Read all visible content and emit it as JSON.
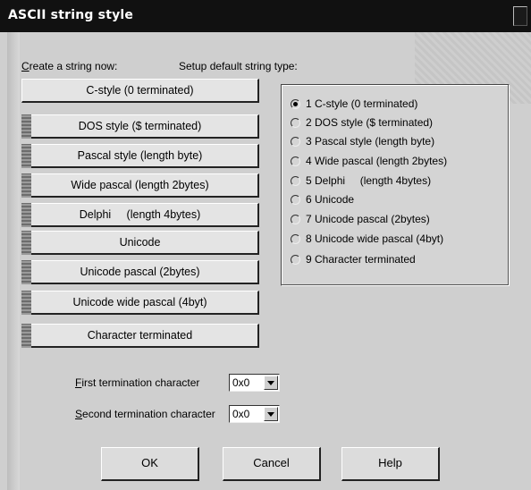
{
  "window": {
    "title": "ASCII string style"
  },
  "labels": {
    "create_prefix": "C",
    "create_rest": "reate a string now:",
    "setup_default": "Setup default string type:"
  },
  "string_buttons": [
    "C-style (0 terminated)",
    "DOS style ($ terminated)",
    "Pascal style (length byte)",
    "Wide pascal (length 2bytes)",
    "Delphi     (length 4bytes)",
    "Unicode",
    "Unicode pascal (2bytes)",
    "Unicode wide pascal (4byt)",
    "Character terminated"
  ],
  "default_types": [
    "1 C-style (0 terminated)",
    "2 DOS style ($ terminated)",
    "3 Pascal style (length byte)",
    "4 Wide pascal (length 2bytes)",
    "5 Delphi     (length 4bytes)",
    "6 Unicode",
    "7 Unicode pascal (2bytes)",
    "8 Unicode wide pascal (4byt)",
    "9 Character terminated"
  ],
  "selected_default_index": 0,
  "termination": {
    "first_label_prefix": "F",
    "first_label_rest": "irst  termination character",
    "first_value": "0x0",
    "second_label_prefix": "S",
    "second_label_rest": "econd termination character",
    "second_value": "0x0"
  },
  "buttons": {
    "ok": "OK",
    "cancel": "Cancel",
    "help": "Help"
  }
}
